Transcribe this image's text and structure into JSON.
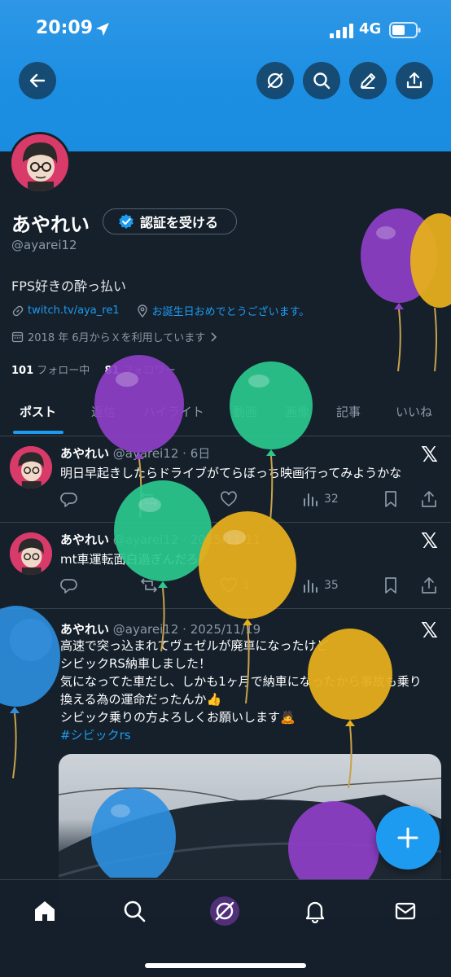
{
  "status_bar": {
    "time": "20:09",
    "network": "4G"
  },
  "header_icons": [
    "back-arrow-icon",
    "grok-icon",
    "search-icon",
    "edit-icon",
    "share-icon"
  ],
  "profile": {
    "name": "あやれい",
    "verify_label": "認証を受ける",
    "handle": "@ayarei12",
    "bio": "FPS好きの酔っ払い",
    "link": "twitch.tv/aya_re1",
    "birthday": "お誕生日おめでとうございます。",
    "joined": "2018 年 6月からＸを利用しています",
    "following_count": "101",
    "following_label": "フォロー中",
    "followers_count": "81",
    "followers_label": "フォロワー"
  },
  "tabs": [
    "ポスト",
    "返信",
    "ハイライト",
    "動画",
    "画像",
    "記事",
    "いいね"
  ],
  "posts": [
    {
      "name": "あやれい",
      "handle": "@ayarei12",
      "date": "6日",
      "text": "明日早起きしたらドライブがてらぼっち映画行ってみようかな",
      "likes": "",
      "views": "32"
    },
    {
      "name": "あやれい",
      "handle": "@ayarei12",
      "date": "2025/11/11",
      "text": "mt車運転面白過ぎんだろ",
      "likes": "1",
      "views": "35"
    },
    {
      "name": "あやれい",
      "handle": "@ayarei12",
      "date": "2025/11/19",
      "text": "高速で突っ込まれてヴェゼルが廃車になったけど\nシビックRS納車しました！\n気になってた車だし、しかも1ヶ月で納車になったから事故も乗り換える為の運命だったんか👍\nシビック乗りの方よろしくお願いします🙇",
      "hashtag": "#シビックrs"
    }
  ],
  "colors": {
    "accent": "#1d9bf0",
    "background": "#15202b",
    "banner": "#1d8fe3"
  }
}
